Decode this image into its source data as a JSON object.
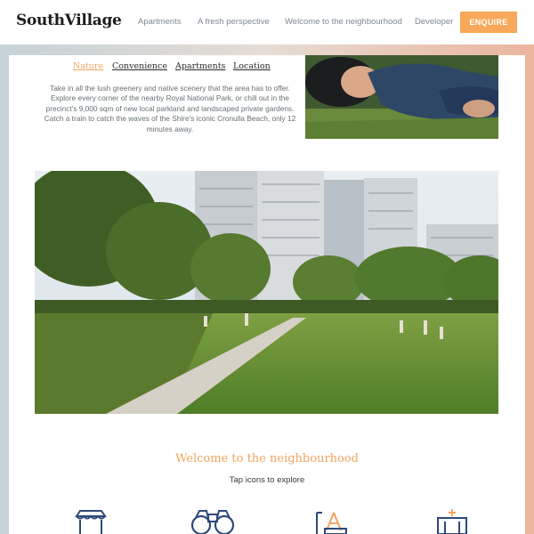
{
  "header": {
    "logo": "SouthVillage",
    "nav": [
      {
        "label": "Apartments"
      },
      {
        "label": "A fresh perspective"
      },
      {
        "label": "Welcome to the neighbourhood"
      },
      {
        "label": "Developer"
      }
    ],
    "cta_label": "ENQUIRE",
    "accent_color": "#f7a959"
  },
  "lifestyle": {
    "tabs": [
      {
        "label": "Nature",
        "active": true
      },
      {
        "label": "Convenience",
        "active": false
      },
      {
        "label": "Apartments",
        "active": false
      },
      {
        "label": "Location",
        "active": false
      }
    ],
    "description": "Take in all the lush greenery and native scenery that the area has to offer. Explore every corner of the nearby Royal National Park, or chill out in the precinct's 9,000 sqm of new local parkland and landscaped private gardens. Catch a train to catch the waves of the Shire's iconic Cronulla Beach, only 12 minutes away."
  },
  "neighbourhood": {
    "title": "Welcome to the neighbourhood",
    "subtitle": "Tap icons to explore",
    "icons": [
      "shop-awning-icon",
      "binoculars-icon",
      "playground-icon",
      "building-icon"
    ],
    "title_color": "#f2a461"
  }
}
